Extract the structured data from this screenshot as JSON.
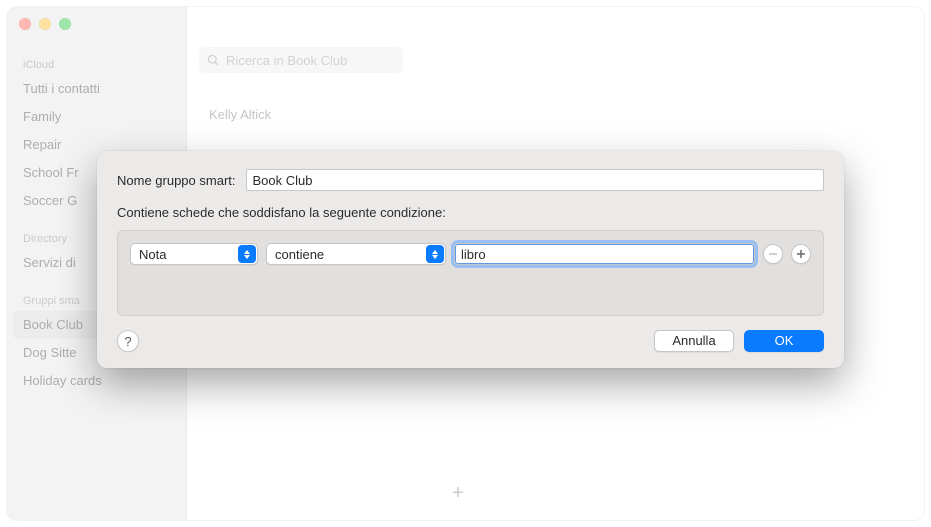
{
  "sidebar": {
    "sections": [
      {
        "header": "iCloud",
        "items": [
          {
            "label": "Tutti i contatti"
          },
          {
            "label": "Family"
          },
          {
            "label": "Repair"
          },
          {
            "label": "School Fr"
          },
          {
            "label": "Soccer G"
          }
        ]
      },
      {
        "header": "Directory",
        "items": [
          {
            "label": "Servizi di"
          }
        ]
      },
      {
        "header": "Gruppi sma",
        "items": [
          {
            "label": "Book Club",
            "selected": true
          },
          {
            "label": "Dog Sitte"
          },
          {
            "label": "Holiday cards"
          }
        ]
      }
    ]
  },
  "search": {
    "placeholder": "Ricerca in Book Club"
  },
  "contacts": {
    "items": [
      {
        "name": "Kelly Altick"
      }
    ]
  },
  "add_button_label": "+",
  "dialog": {
    "name_label": "Nome gruppo smart:",
    "name_value": "Book Club",
    "condition_label": "Contiene schede che soddisfano la seguente condizione:",
    "rules": [
      {
        "field": "Nota",
        "op": "contiene",
        "value": "libro"
      }
    ],
    "help_label": "?",
    "cancel_label": "Annulla",
    "ok_label": "OK"
  },
  "colors": {
    "accent": "#0a7aff",
    "focus_ring": "#98bff2"
  }
}
